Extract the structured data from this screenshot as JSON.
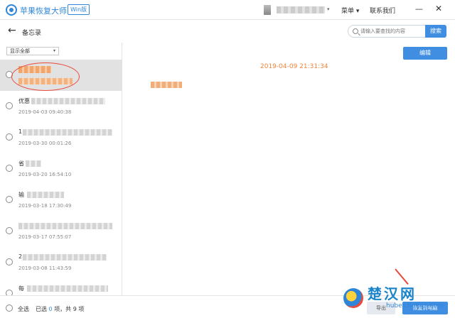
{
  "titlebar": {
    "app_title": "苹果恢复大师",
    "edition": "Win版",
    "menu_label": "菜单",
    "contact_label": "联系我们",
    "caret": "▾",
    "minimize": "—",
    "close": "✕"
  },
  "header": {
    "back": "←",
    "title": "备忘录",
    "search_placeholder": "请输入要查找的内容",
    "search_button": "搜索"
  },
  "filter": {
    "selected": "显示全部",
    "caret": "▾"
  },
  "notes": [
    {
      "title": "",
      "date": ""
    },
    {
      "title": "优惠",
      "date": "2019-04-03 09:40:38"
    },
    {
      "title": "1",
      "date": "2019-03-30 00:01:26"
    },
    {
      "title": "省",
      "date": "2019-03-20 16:54:10"
    },
    {
      "title": "输",
      "date": "2019-03-18 17:30:49"
    },
    {
      "title": "",
      "date": "2019-03-17 07:55:07"
    },
    {
      "title": "2",
      "date": "2019-03-08 11:43:59"
    },
    {
      "title": "每",
      "date": ""
    }
  ],
  "detail": {
    "edit_button": "编辑",
    "timestamp": "2019-04-09 21:31:34"
  },
  "footer": {
    "select_all": "全选",
    "selected_prefix": "已选",
    "selected_count": "0",
    "selected_mid": "项，共",
    "total_count": "9",
    "total_suffix": "项",
    "button_export": "导出",
    "button_recover": "恢复到电脑"
  },
  "watermark": {
    "text": "楚汉网",
    "url": "hubeichuhan.com"
  },
  "colors": {
    "accent": "#3f8ee2",
    "timestamp": "#f0843a",
    "annotation": "#e94b3c"
  }
}
